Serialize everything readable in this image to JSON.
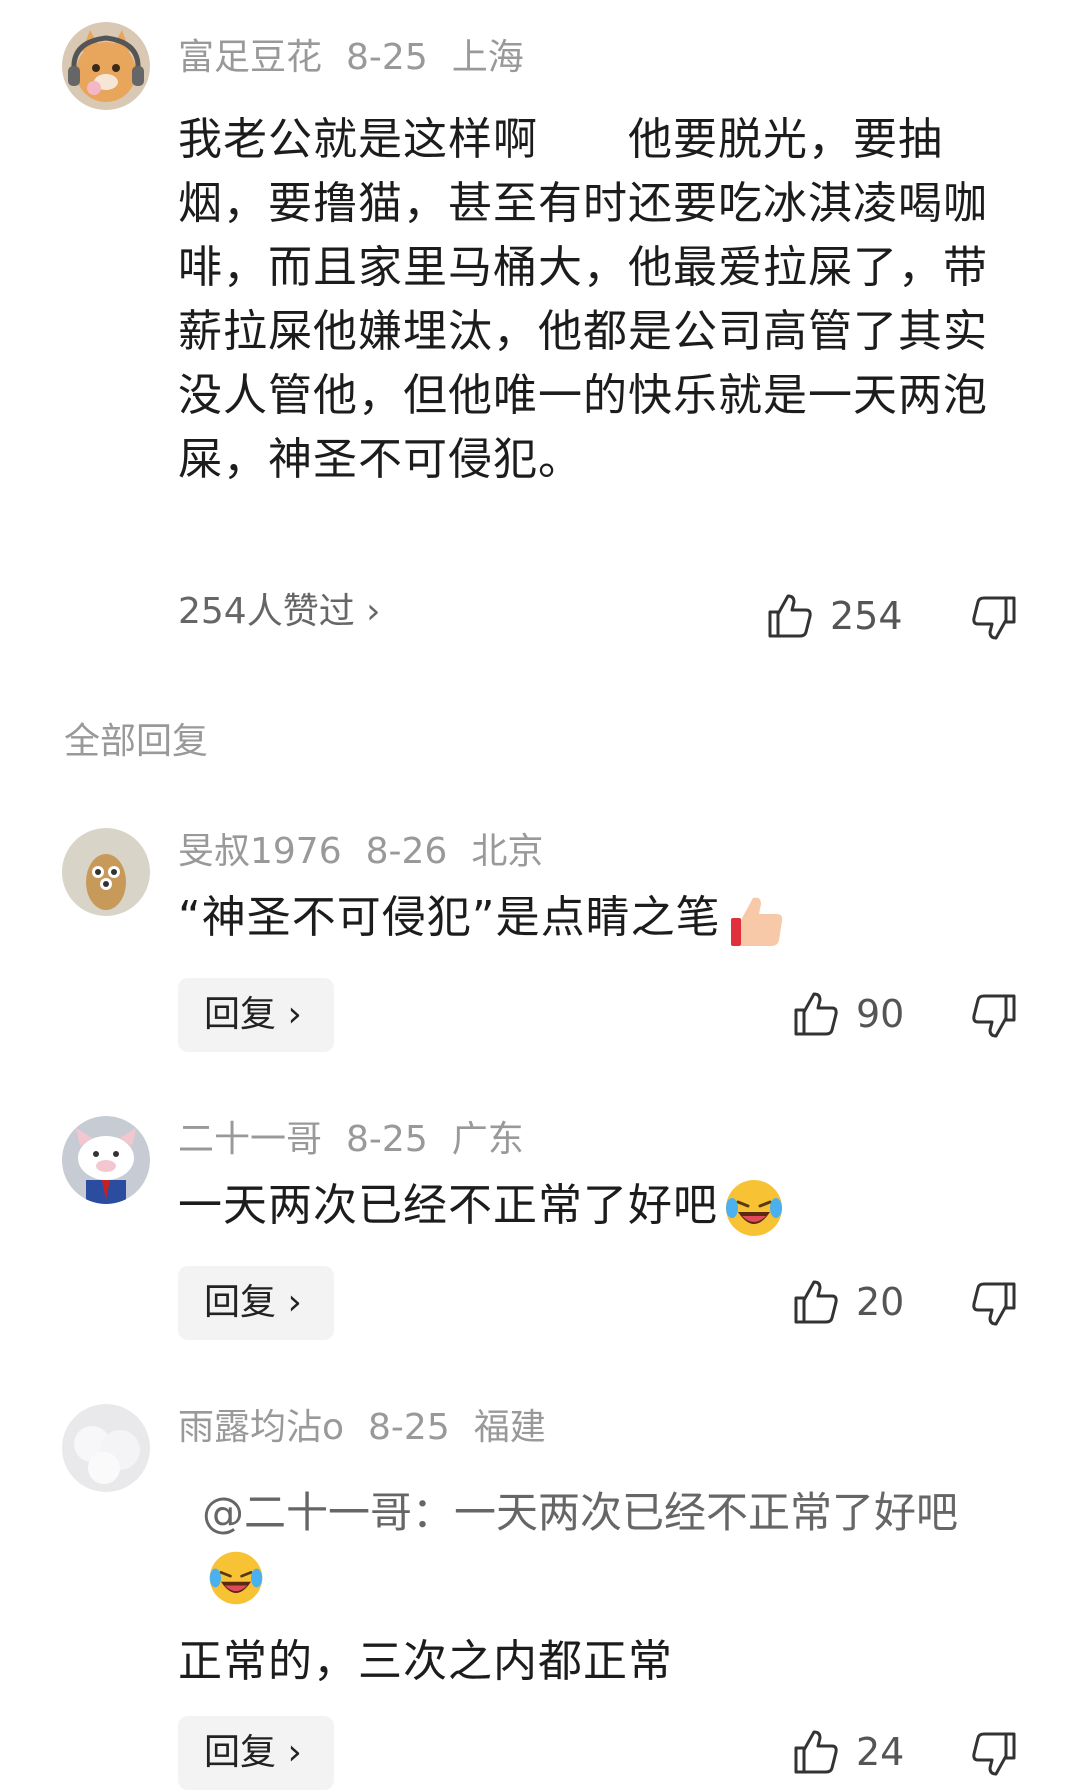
{
  "comment": {
    "user": "富足豆花",
    "date": "8-25",
    "location": "上海",
    "text": "我老公就是这样啊　　他要脱光，要抽烟，要撸猫，甚至有时还要吃冰淇凌喝咖啡，而且家里马桶大，他最爱拉屎了，带薪拉屎他嫌埋汰，他都是公司高管了其实没人管他，但他唯一的快乐就是一天两泡屎，神圣不可侵犯。",
    "likers_label": "254人赞过 ›",
    "like_count": "254"
  },
  "section_title": "全部回复",
  "replies": [
    {
      "user": "旻叔1976",
      "date": "8-26",
      "location": "北京",
      "text": "“神圣不可侵犯”是点睛之笔",
      "emoji": "thumbs-up-emoji",
      "reply_label": "回复 ›",
      "like_count": "90"
    },
    {
      "user": "二十一哥",
      "date": "8-25",
      "location": "广东",
      "text": "一天两次已经不正常了好吧",
      "emoji": "laughing-crying-emoji",
      "reply_label": "回复 ›",
      "like_count": "20"
    },
    {
      "user": "雨露均沾o",
      "date": "8-25",
      "location": "福建",
      "quote": "@二十一哥：一天两次已经不正常了好吧",
      "quote_emoji": "laughing-crying-emoji",
      "text": "正常的，三次之内都正常",
      "reply_label": "回复 ›",
      "like_count": "24"
    }
  ],
  "icons": {
    "like": "thumbs-up-outline-icon",
    "dislike": "thumbs-down-outline-icon"
  },
  "colors": {
    "meta": "#999999",
    "text": "#1c1c1c",
    "reply_bg": "#f3f3f3"
  }
}
